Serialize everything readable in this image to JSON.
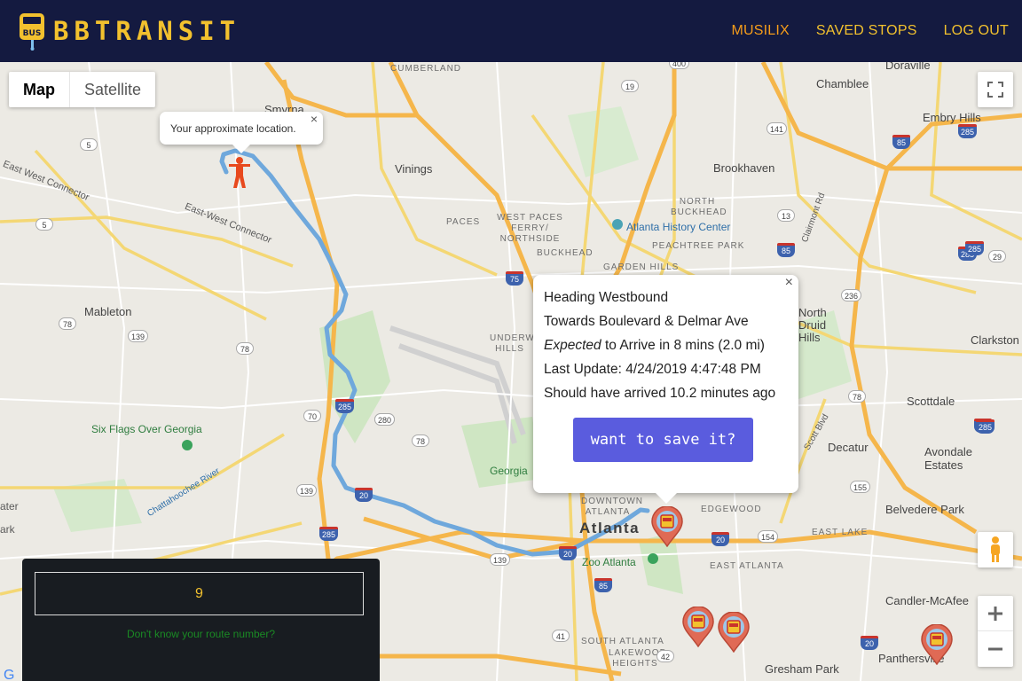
{
  "app": {
    "logo_badge": "BUS",
    "name": "BBTRANSIT"
  },
  "nav": {
    "items": [
      {
        "label": "MUSILIX",
        "color": "#f59c1a"
      },
      {
        "label": "SAVED STOPS",
        "color": "#f2c12e"
      },
      {
        "label": "LOG OUT",
        "color": "#f2c12e"
      }
    ]
  },
  "map": {
    "type_control": {
      "map": "Map",
      "satellite": "Satellite"
    },
    "labels": {
      "cumberland": "CUMBERLAND",
      "smyrna": "Smyrna",
      "vinings": "Vinings",
      "chamblee": "Chamblee",
      "doraville": "Doraville",
      "embry_hills": "Embry Hills",
      "brookhaven": "Brookhaven",
      "north_buckhead": "NORTH BUCKHEAD",
      "paces": "PACES",
      "west_paces": "WEST PACES FERRY/ NORTHSIDE",
      "buckhead": "BUCKHEAD",
      "atlanta_history": "Atlanta History Center",
      "peachtree_park": "PEACHTREE PARK",
      "garden_hills": "GARDEN HILLS",
      "mableton": "Mableton",
      "east_west_connector": "East-West Connector",
      "west_connector": "East West Connector",
      "six_flags": "Six Flags Over Georgia",
      "chattahoochee": "Chattahoochee River",
      "clarkston": "Clarkston",
      "north_hills": "North Druid Hills",
      "scottdale": "Scottdale",
      "decatur": "Decatur",
      "avondale": "Avondale Estates",
      "belvedere": "Belvedere Park",
      "candler": "Candler-McAfee",
      "panthersville": "Panthersville",
      "gresham": "Gresham Park",
      "downtown": "DOWNTOWN ATLANTA",
      "atlanta": "Atlanta",
      "edgewood": "EDGEWOOD",
      "east_lake": "EAST LAKE",
      "east_atlanta": "EAST ATLANTA",
      "zoo": "Zoo Atlanta",
      "south_atlanta": "SOUTH ATLANTA",
      "lakewood": "LAKEWOOD HEIGHTS",
      "georgia": "Georgia",
      "underwood": "UNDERWOOD HILLS",
      "water": "ater",
      "park": "ark",
      "clairmont": "Clairmont Rd",
      "scott_blvd": "Scott Blvd"
    },
    "shields": [
      "400",
      "19",
      "141",
      "85",
      "285",
      "5",
      "13",
      "285",
      "75",
      "236",
      "285",
      "78",
      "139",
      "78",
      "70",
      "280",
      "285",
      "78",
      "20",
      "139",
      "285",
      "20",
      "155",
      "139",
      "85",
      "41",
      "42",
      "20",
      "29",
      "85",
      "154",
      "20",
      "85",
      "78",
      "285",
      "280",
      "5"
    ]
  },
  "location_tooltip": {
    "text": "Your approximate location.",
    "close": "×"
  },
  "bus_popup": {
    "close": "×",
    "heading": "Heading Westbound",
    "towards": "Towards Boulevard & Delmar Ave",
    "expected_word": "Expected",
    "expected_rest": " to Arrive in 8 mins (2.0 mi)",
    "last_update": "Last Update: 4/24/2019 4:47:48 PM",
    "overdue": "Should have arrived 10.2 minutes ago",
    "save_button": "want to save it?"
  },
  "route_panel": {
    "route_value": "9",
    "help_link": "Don't know your route number?"
  },
  "colors": {
    "navbar": "#141a40",
    "accent_yellow": "#f2c12e",
    "accent_orange": "#f59c1a",
    "route_line": "#6fa8dc",
    "save_button": "#5a5cde",
    "help_link": "#1a8a24"
  }
}
